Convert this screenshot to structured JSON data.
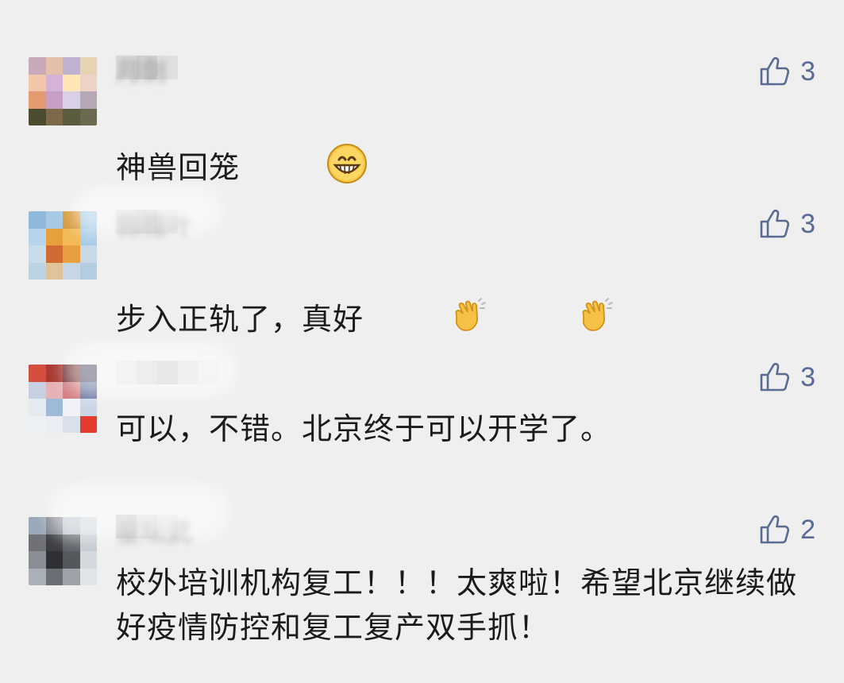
{
  "comments": [
    {
      "author": "月剑",
      "text": "神兽回笼",
      "emoji": "grinning-face-emoji",
      "likes": "3",
      "avatar_colors": [
        "#c9a9b9",
        "#e4c0a8",
        "#bfb2cf",
        "#e6d3b0",
        "#f2c6a8",
        "#d5b3d6",
        "#ffe6b8",
        "#efd2c6",
        "#e49a70",
        "#c79fc4",
        "#d9cfe6",
        "#b5a7b3",
        "#4a4b2f",
        "#7c6a4a",
        "#5a5b3f",
        "#6b6a50"
      ]
    },
    {
      "author": "微槐叶",
      "text": "步入正轨了，真好",
      "emoji": "clapping-hands-emoji",
      "likes": "3",
      "avatar_colors": [
        "#8fb9da",
        "#a8c9e6",
        "#d69a3a",
        "#9cc5e2",
        "#b7d4ea",
        "#e7a13c",
        "#f2b955",
        "#a6cbe6",
        "#c9dcea",
        "#d16a32",
        "#e89f3f",
        "#c7d8e6",
        "#bcd3e3",
        "#e1c39a",
        "#c6d6e4",
        "#b2cce0"
      ]
    },
    {
      "author": "某人",
      "text": "可以，不错。北京终于可以开学了。",
      "emoji": "",
      "likes": "3",
      "avatar_colors": [
        "#d44e3f",
        "#a83a33",
        "#6b2c2c",
        "#3d3a57",
        "#c7cfe0",
        "#e6b2b6",
        "#d07a7d",
        "#5b6d9a",
        "#e5e9f0",
        "#9fbad6",
        "#f0f2f5",
        "#c9d6e6",
        "#eef1f4",
        "#e8eef3",
        "#d8e0ea",
        "#e23c2f"
      ]
    },
    {
      "author": "星坛武",
      "text": "校外培训机构复工！！！太爽啦！希望北京继续做好疫情防控和复工复产双手抓！",
      "emoji": "",
      "likes": "2",
      "avatar_colors": [
        "#9aa7b8",
        "#7a7f88",
        "#b7bec8",
        "#cfd5db",
        "#6f7177",
        "#3b3d42",
        "#5b5e64",
        "#c3c9cf",
        "#8a8d93",
        "#2e3034",
        "#54575c",
        "#d5d9de",
        "#aab0b8",
        "#6b6e74",
        "#9ea3aa",
        "#e2e5e8"
      ]
    }
  ],
  "colors": {
    "background": "#efefef",
    "text": "#1b1b1b",
    "like_accent": "#576b95",
    "author": "#9a9a9a"
  }
}
